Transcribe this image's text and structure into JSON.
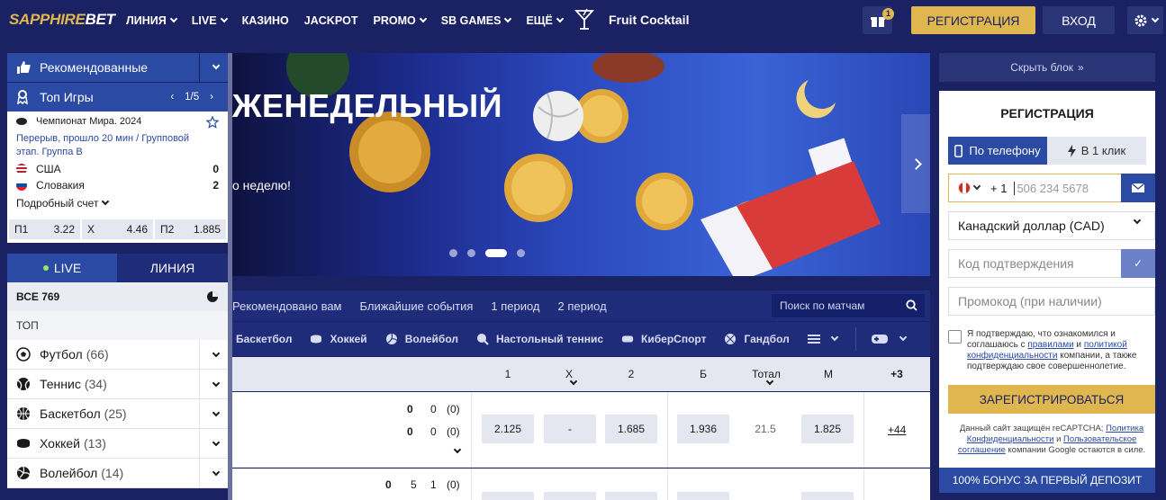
{
  "brand": {
    "logo_a": "SAPPHIRE",
    "logo_b": "BET"
  },
  "nav": {
    "items": [
      {
        "label": "ЛИНИЯ",
        "has_dropdown": true
      },
      {
        "label": "LIVE",
        "has_dropdown": true
      },
      {
        "label": "КАЗИНО",
        "has_dropdown": false
      },
      {
        "label": "JACKPOT",
        "has_dropdown": false
      },
      {
        "label": "PROMO",
        "has_dropdown": true
      },
      {
        "label": "SB GAMES",
        "has_dropdown": true
      },
      {
        "label": "ЕЩЁ",
        "has_dropdown": true
      }
    ],
    "promo_game": "Fruit Cocktail",
    "gift_badge": "1",
    "register_label": "РЕГИСТРАЦИЯ",
    "login_label": "ВХОД"
  },
  "sidebar": {
    "recommended": "Рекомендованные",
    "top_games": "Топ Игры",
    "pager": "1/5",
    "match": {
      "league": "Чемпионат Мира. 2024",
      "status": "Перерыв, прошло 20 мин / Групповой этап. Группа B",
      "team1": "США",
      "score1": "0",
      "team2": "Словакия",
      "score2": "2",
      "details": "Подробный счет",
      "odds": [
        {
          "label": "П1",
          "value": "3.22"
        },
        {
          "label": "X",
          "value": "4.46"
        },
        {
          "label": "П2",
          "value": "1.885"
        }
      ]
    },
    "tab_live": "LIVE",
    "tab_line": "ЛИНИЯ",
    "all_label": "ВСЕ 769",
    "top_label": "ТОП",
    "sports": [
      {
        "name": "Футбол",
        "count": "(66)",
        "icon": "football-icon"
      },
      {
        "name": "Теннис",
        "count": "(34)",
        "icon": "tennis-icon"
      },
      {
        "name": "Баскетбол",
        "count": "(25)",
        "icon": "basketball-icon"
      },
      {
        "name": "Хоккей",
        "count": "(13)",
        "icon": "hockey-icon"
      },
      {
        "name": "Волейбол",
        "count": "(14)",
        "icon": "volleyball-icon"
      }
    ]
  },
  "banner": {
    "title": "ЖЕНЕДЕЛЬНЫЙ",
    "subtitle": "о неделю!"
  },
  "filters": {
    "items": [
      "Рекомендовано вам",
      "Ближайшие события",
      "1 период",
      "2 период"
    ],
    "search_placeholder": "Поиск по матчам"
  },
  "sports_bar": [
    "Баскетбол",
    "Хоккей",
    "Волейбол",
    "Настольный теннис",
    "КиберСпорт",
    "Гандбол"
  ],
  "table": {
    "headers": [
      "1",
      "X",
      "2",
      "Б",
      "Тотал",
      "М",
      "+3"
    ],
    "row1": {
      "scores": [
        [
          "0",
          "0",
          "(0)"
        ],
        [
          "0",
          "0",
          "(0)"
        ]
      ],
      "odds": [
        "2.125",
        "-",
        "1.685",
        "1.936",
        "21.5",
        "1.825"
      ],
      "more": "+44"
    },
    "row2": {
      "scores": [
        "0",
        "5",
        "1",
        "(0)"
      ]
    }
  },
  "right": {
    "hide_label": "Скрыть блок",
    "title": "РЕГИСТРАЦИЯ",
    "tab_phone": "По телефону",
    "tab_oneclick": "В 1 клик",
    "phone_code": "+ 1",
    "phone_placeholder": "506 234 5678",
    "currency": "Канадский доллар (CAD)",
    "code_placeholder": "Код подтверждения",
    "promo_placeholder": "Промокод (при наличии)",
    "consent_1": "Я подтверждаю, что ознакомился и соглашаюсь с ",
    "consent_link1": "правилами",
    "consent_2": " и ",
    "consent_link2": "политикой конфиденциальности",
    "consent_3": " компании, а также подтверждаю свое совершеннолетие.",
    "register_button": "ЗАРЕГИСТРИРОВАТЬСЯ",
    "captcha_1": "Данный сайт защищён reCAPTCHA; ",
    "captcha_link1": "Политика Конфиденциальности",
    "captcha_2": " и ",
    "captcha_link2": "Пользовательское соглашение",
    "captcha_3": " компании Google остаются в силе.",
    "bonus": "100% БОНУС ЗА ПЕРВЫЙ ДЕПОЗИТ"
  },
  "colors": {
    "bg": "#1a2263",
    "accent": "#e0b64e",
    "blue": "#2a4aa3"
  }
}
